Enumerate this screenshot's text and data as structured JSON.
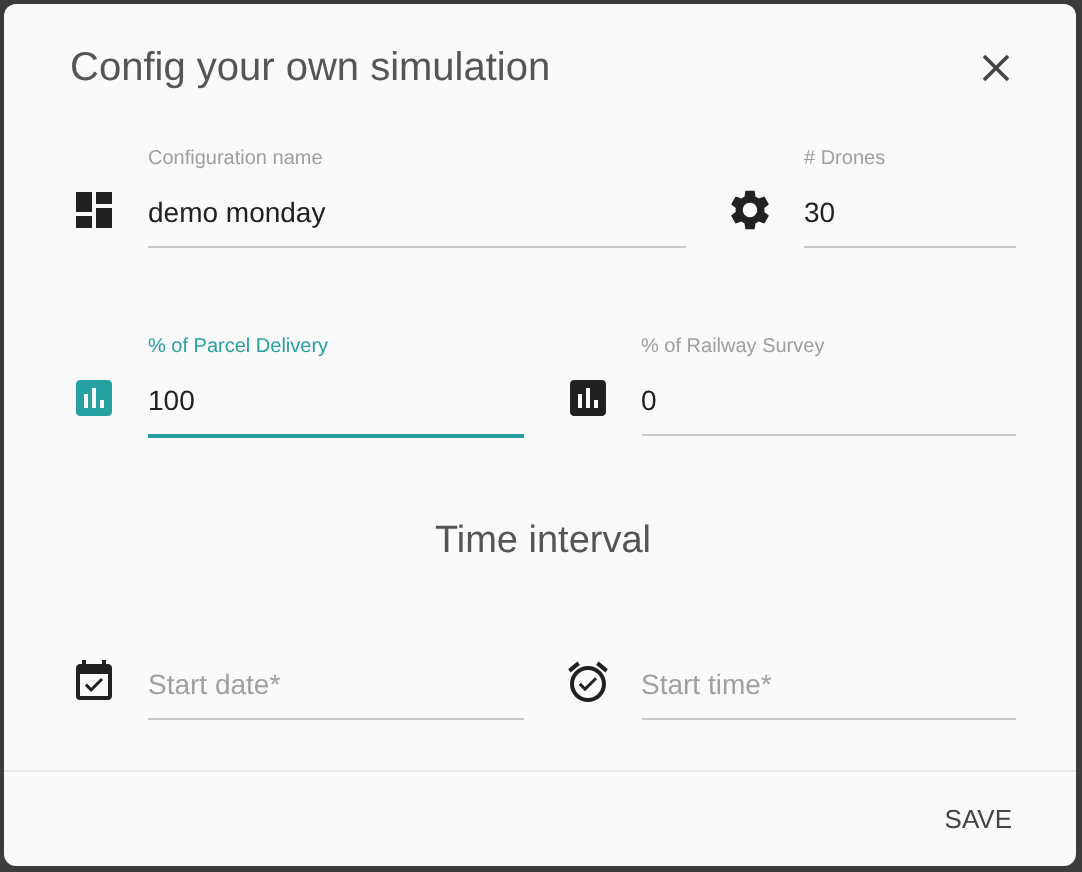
{
  "dialog": {
    "title": "Config your own simulation"
  },
  "sections": [
    {
      "rows": [
        {
          "fields": [
            {
              "kind": "dashboard",
              "label": "Configuration name",
              "value": "demo monday",
              "focused": false
            },
            {
              "kind": "gear",
              "label": "# Drones",
              "value": "30",
              "focused": false
            }
          ]
        },
        {
          "fields": [
            {
              "kind": "chart",
              "label": "% of Parcel Delivery",
              "value": "100",
              "focused": true
            },
            {
              "kind": "chart",
              "label": "% of Railway Survey",
              "value": "0",
              "focused": false
            }
          ]
        }
      ]
    },
    {
      "title": "Time interval",
      "rows": [
        {
          "fields": [
            {
              "kind": "date",
              "placeholder": "Start date*",
              "focused": false
            },
            {
              "kind": "time",
              "placeholder": "Start time*",
              "focused": false
            }
          ]
        }
      ]
    }
  ],
  "actions": [
    {
      "label": "SAVE"
    }
  ]
}
